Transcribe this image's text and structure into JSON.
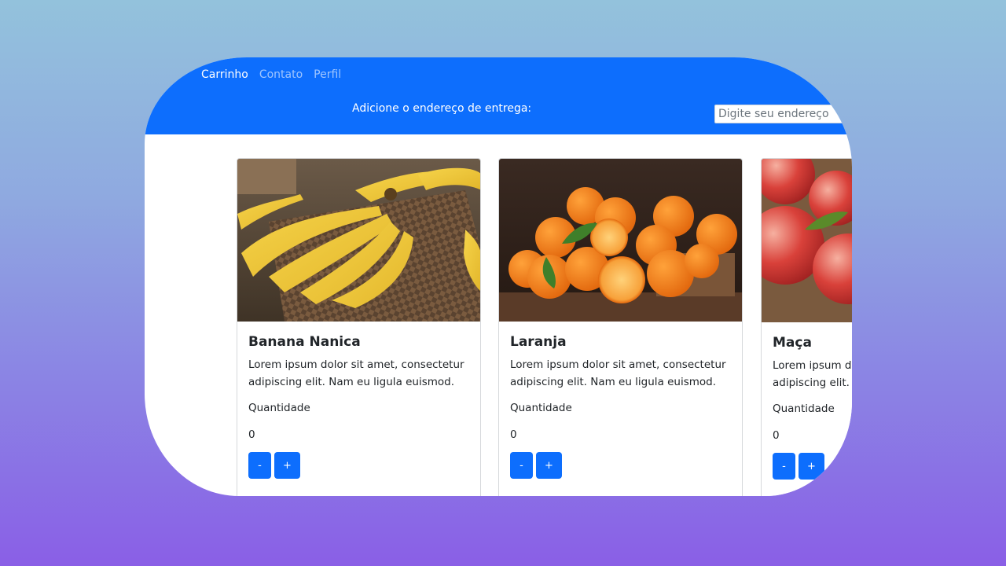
{
  "navbar": {
    "links": [
      "Carrinho",
      "Contato",
      "Perfil"
    ],
    "address_label": "Adicione o endereço de entrega:",
    "address_placeholder": "Digite seu endereço"
  },
  "products": [
    {
      "title": "Banana Nanica",
      "description": "Lorem ipsum dolor sit amet, consectetur adipiscing elit. Nam eu ligula euismod.",
      "quantity_label": "Quantidade",
      "quantity": "0",
      "minus_label": "-",
      "plus_label": "+",
      "image": "banana-photo"
    },
    {
      "title": "Laranja",
      "description": "Lorem ipsum dolor sit amet, consectetur adipiscing elit. Nam eu ligula euismod.",
      "quantity_label": "Quantidade",
      "quantity": "0",
      "minus_label": "-",
      "plus_label": "+",
      "image": "orange-photo"
    },
    {
      "title": "Maça",
      "description": "Lorem ipsum dolor sit amet, consectetur adipiscing elit. Nam eu ligula euismod.",
      "quantity_label": "Quantidade",
      "quantity": "0",
      "minus_label": "-",
      "plus_label": "+",
      "image": "apple-photo"
    }
  ],
  "colors": {
    "primary": "#0d6efd",
    "background_top": "#93c2dc",
    "background_bottom": "#8a5fe6"
  }
}
